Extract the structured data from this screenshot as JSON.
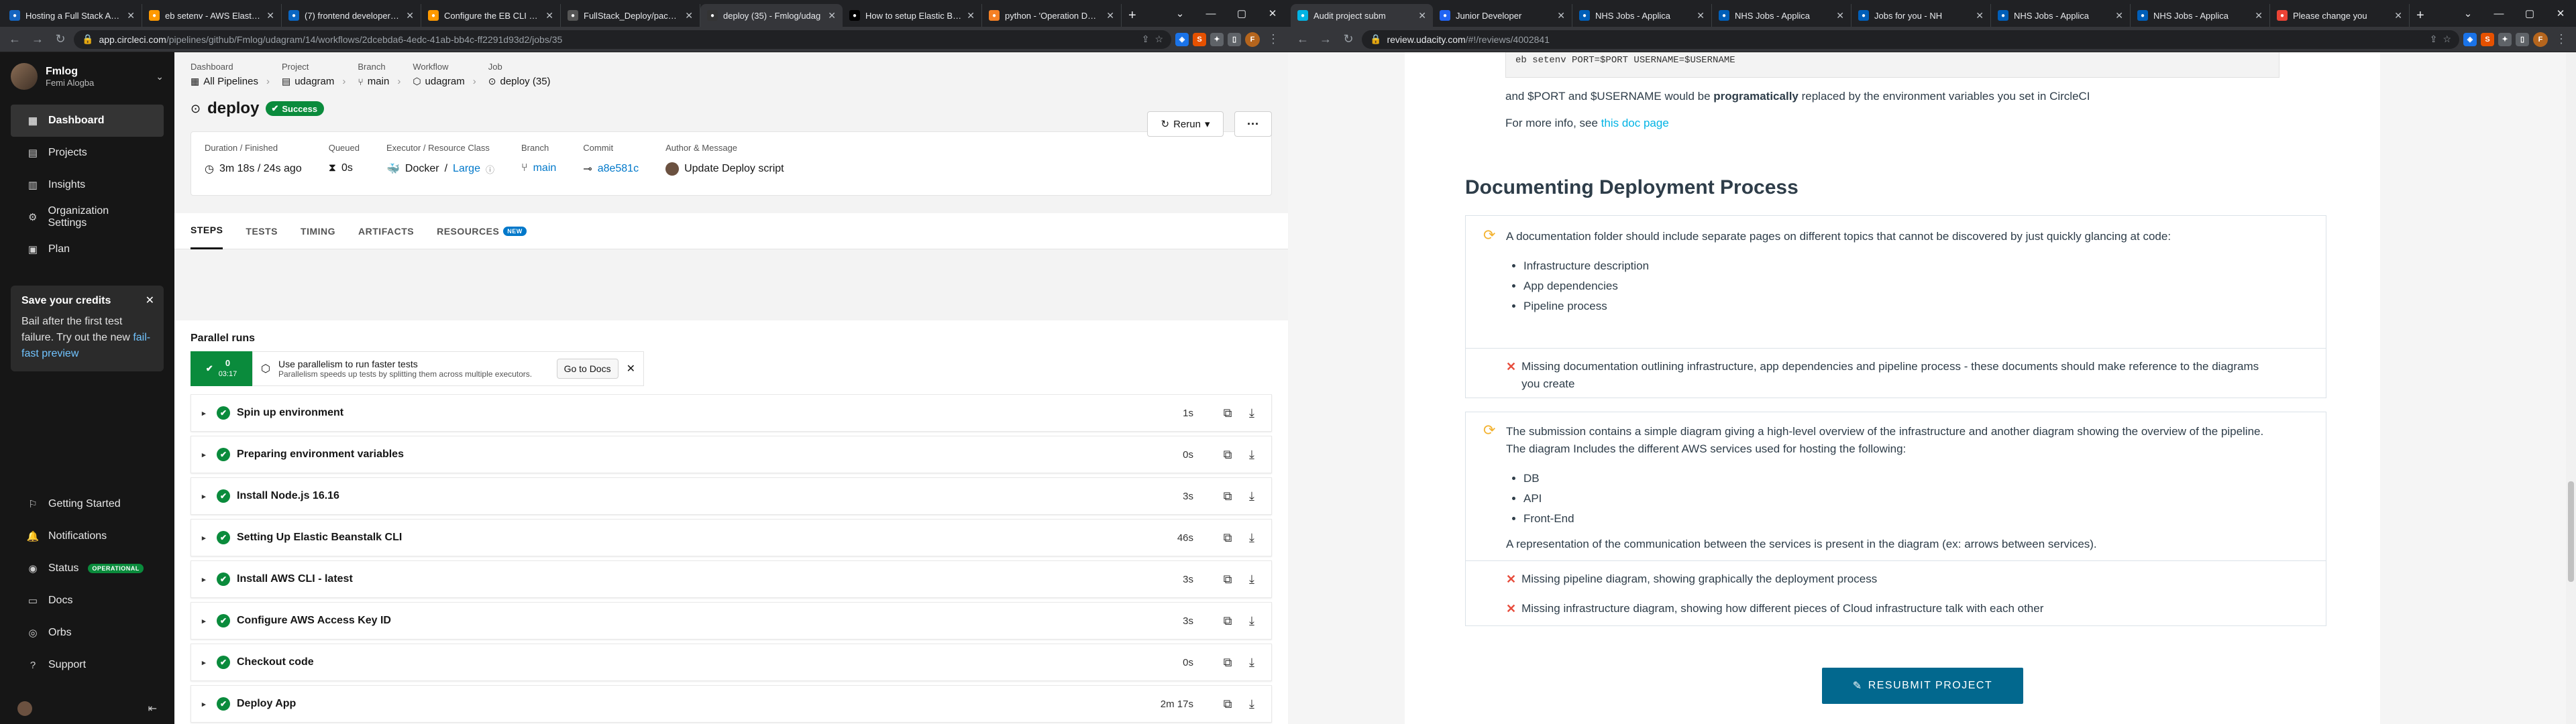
{
  "left_window": {
    "tabs": [
      {
        "title": "Hosting a Full Stack Appli",
        "icon": "udacity-icon",
        "color": "#1565c0",
        "active": false
      },
      {
        "title": "eb setenv - AWS Elastic Be",
        "icon": "aws-icon",
        "color": "#ff9900",
        "active": false
      },
      {
        "title": "(7) frontend developer Jo",
        "icon": "linkedin-icon",
        "color": "#0a66c2",
        "active": false
      },
      {
        "title": "Configure the EB CLI - AW",
        "icon": "aws-icon",
        "color": "#ff9900",
        "active": false
      },
      {
        "title": "FullStack_Deploy/packag",
        "icon": "github-icon",
        "color": "#555555",
        "active": false
      },
      {
        "title": "deploy (35) - Fmlog/udag",
        "icon": "circleci-icon",
        "color": "#343434",
        "active": true
      },
      {
        "title": "How to setup Elastic Bean",
        "icon": "medium-icon",
        "color": "#000000",
        "active": false
      },
      {
        "title": "python - 'Operation Denie",
        "icon": "stackoverflow-icon",
        "color": "#f48024",
        "active": false
      }
    ],
    "url_host": "app.circleci.com",
    "url_path": "/pipelines/github/Fmlog/udagram/14/workflows/2dcebda6-4edc-41ab-bb4c-ff2291d93d2/jobs/35"
  },
  "sidebar": {
    "org_name": "Fmlog",
    "org_user": "Femi Alogba",
    "items": [
      {
        "label": "Dashboard",
        "icon": "dashboard-icon",
        "glyph": "▦",
        "active": true
      },
      {
        "label": "Projects",
        "icon": "projects-icon",
        "glyph": "▤",
        "active": false
      },
      {
        "label": "Insights",
        "icon": "insights-icon",
        "glyph": "▥",
        "active": false
      },
      {
        "label": "Organization Settings",
        "icon": "gear-icon",
        "glyph": "⚙",
        "active": false
      },
      {
        "label": "Plan",
        "icon": "plan-icon",
        "glyph": "▣",
        "active": false
      }
    ],
    "promo": {
      "title": "Save your credits",
      "text": "Bail after the first test failure. Try out the new",
      "link": "fail-fast preview"
    },
    "bottom_items": [
      {
        "label": "Getting Started",
        "icon": "rocket-icon",
        "glyph": "⚐"
      },
      {
        "label": "Notifications",
        "icon": "bell-icon",
        "glyph": "🔔"
      },
      {
        "label": "Status",
        "icon": "status-icon",
        "glyph": "◉",
        "badge": "OPERATIONAL"
      },
      {
        "label": "Docs",
        "icon": "docs-icon",
        "glyph": "▭"
      },
      {
        "label": "Orbs",
        "icon": "orbs-icon",
        "glyph": "◎"
      },
      {
        "label": "Support",
        "icon": "support-icon",
        "glyph": "?"
      }
    ]
  },
  "breadcrumbs": [
    {
      "label": "Dashboard",
      "value": "All Pipelines",
      "icon": "pipelines-icon"
    },
    {
      "label": "Project",
      "value": "udagram",
      "icon": "project-icon"
    },
    {
      "label": "Branch",
      "value": "main",
      "icon": "branch-icon"
    },
    {
      "label": "Workflow",
      "value": "udagram",
      "icon": "workflow-icon"
    },
    {
      "label": "Job",
      "value": "deploy (35)",
      "icon": "job-icon"
    }
  ],
  "job": {
    "title": "deploy",
    "status": "Success",
    "rerun_label": "Rerun",
    "meta": {
      "duration_label": "Duration / Finished",
      "duration_value": "3m 18s / 24s ago",
      "queued_label": "Queued",
      "queued_value": "0s",
      "executor_label": "Executor / Resource Class",
      "executor_value": "Docker",
      "executor_class": "Large",
      "branch_label": "Branch",
      "branch_value": "main",
      "commit_label": "Commit",
      "commit_value": "a8e581c",
      "author_label": "Author & Message",
      "author_value": "Update Deploy script"
    }
  },
  "tabs": [
    {
      "label": "STEPS",
      "active": true
    },
    {
      "label": "TESTS",
      "active": false
    },
    {
      "label": "TIMING",
      "active": false
    },
    {
      "label": "ARTIFACTS",
      "active": false
    },
    {
      "label": "RESOURCES",
      "active": false,
      "badge": "NEW"
    }
  ],
  "parallel": {
    "title": "Parallel runs",
    "index": "0",
    "time": "03:17",
    "headline": "Use parallelism to run faster tests",
    "sub": "Parallelism speeds up tests by splitting them across multiple executors.",
    "docs_label": "Go to Docs"
  },
  "steps": [
    {
      "name": "Spin up environment",
      "duration": "1s"
    },
    {
      "name": "Preparing environment variables",
      "duration": "0s"
    },
    {
      "name": "Install Node.js 16.16",
      "duration": "3s"
    },
    {
      "name": "Setting Up Elastic Beanstalk CLI",
      "duration": "46s"
    },
    {
      "name": "Install AWS CLI - latest",
      "duration": "3s"
    },
    {
      "name": "Configure AWS Access Key ID",
      "duration": "3s"
    },
    {
      "name": "Checkout code",
      "duration": "0s"
    },
    {
      "name": "Deploy App",
      "duration": "2m 17s"
    }
  ],
  "right_window": {
    "tabs": [
      {
        "title": "Audit project subm",
        "icon": "udacity-icon",
        "color": "#02b3e4",
        "active": true
      },
      {
        "title": "Junior Developer",
        "icon": "indeed-icon",
        "color": "#2164f3",
        "active": false
      },
      {
        "title": "NHS Jobs - Applica",
        "icon": "nhs-icon",
        "color": "#005eb8",
        "active": false
      },
      {
        "title": "NHS Jobs - Applica",
        "icon": "nhs-icon",
        "color": "#005eb8",
        "active": false
      },
      {
        "title": "Jobs for you - NH",
        "icon": "nhs-icon",
        "color": "#005eb8",
        "active": false
      },
      {
        "title": "NHS Jobs - Applica",
        "icon": "nhs-icon",
        "color": "#005eb8",
        "active": false
      },
      {
        "title": "NHS Jobs - Applica",
        "icon": "nhs-icon",
        "color": "#005eb8",
        "active": false
      },
      {
        "title": "Please change you",
        "icon": "gmail-icon",
        "color": "#ea4335",
        "active": false
      }
    ],
    "url_host": "review.udacity.com",
    "url_path": "/#!/reviews/4002841"
  },
  "review": {
    "code_fragment": "eb setenv PORT=$PORT USERNAME=$USERNAME",
    "env_note_pre": "and $PORT and $USERNAME would be ",
    "env_note_bold": "programatically",
    "env_note_post": " replaced by the environment variables you set in CircleCI",
    "more_info_pre": "For more info, see ",
    "more_info_link": "this doc page",
    "section_title": "Documenting Deployment Process",
    "criteria": [
      {
        "text": "A documentation folder should include separate pages on different topics that cannot be discovered by just quickly glancing at code:",
        "bullets": [
          "Infrastructure description",
          "App dependencies",
          "Pipeline process"
        ],
        "extra": "",
        "missing": [
          "Missing documentation outlining infrastructure, app dependencies and pipeline process - these documents should make reference to the diagrams you create"
        ]
      },
      {
        "text": "The submission contains a simple diagram giving a high-level overview of the infrastructure and another diagram showing the overview of the pipeline. The diagram Includes the different AWS services used for hosting the following:",
        "bullets": [
          "DB",
          "API",
          "Front-End"
        ],
        "extra": "A representation of the communication between the services is present in the diagram (ex: arrows between services).",
        "missing": [
          "Missing pipeline diagram, showing graphically the deployment process",
          "Missing infrastructure diagram, showing how different pieces of Cloud infrastructure talk with each other"
        ]
      }
    ],
    "resubmit_label": "RESUBMIT PROJECT"
  }
}
